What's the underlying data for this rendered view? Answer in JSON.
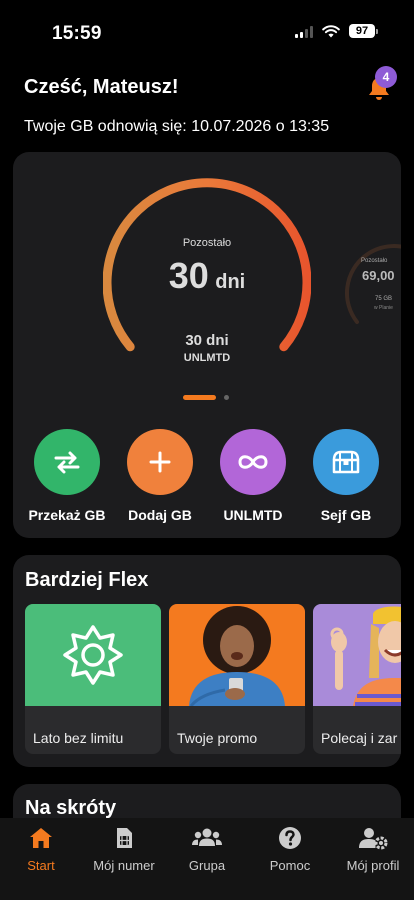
{
  "status_bar": {
    "time": "15:59",
    "battery": "97"
  },
  "header": {
    "greeting": "Cześć, Mateusz!",
    "notification_count": "4",
    "renewal_text": "Twoje GB odnowią się: 10.07.2026 o 13:35"
  },
  "data_card": {
    "gauge_main": {
      "caption": "Pozostało",
      "value": "30",
      "unit": "dni",
      "sub_value": "30 dni",
      "sub_label": "UNLMTD",
      "fill_fraction": 1.0
    },
    "gauge_peek": {
      "caption": "Pozostało",
      "value": "69,00",
      "gb_text": "75 GB",
      "plan_text": "w Planie"
    },
    "pager": {
      "pages": 2,
      "active": 0
    },
    "actions": [
      {
        "label": "Przekaż GB",
        "icon": "transfer-icon",
        "color": "#32b56a"
      },
      {
        "label": "Dodaj GB",
        "icon": "plus-icon",
        "color": "#f0813c"
      },
      {
        "label": "UNLMTD",
        "icon": "infinity-icon",
        "color": "#b266d8"
      },
      {
        "label": "Sejf GB",
        "icon": "treasure-chest-icon",
        "color": "#3a9bdc"
      }
    ]
  },
  "flex": {
    "title": "Bardziej Flex",
    "promos": [
      {
        "caption": "Lato bez limitu",
        "image": "sun-icon"
      },
      {
        "caption": "Twoje promo",
        "image": "woman-with-phone-photo"
      },
      {
        "caption": "Polecaj i zar",
        "image": "smiling-woman-photo"
      }
    ]
  },
  "shortcuts": {
    "title": "Na skróty"
  },
  "tab_bar": [
    {
      "label": "Start",
      "icon": "home-icon",
      "active": true
    },
    {
      "label": "Mój numer",
      "icon": "sim-card-icon",
      "active": false
    },
    {
      "label": "Grupa",
      "icon": "group-icon",
      "active": false
    },
    {
      "label": "Pomoc",
      "icon": "help-icon",
      "active": false
    },
    {
      "label": "Mój profil",
      "icon": "profile-settings-icon",
      "active": false
    }
  ],
  "colors": {
    "accent": "#f47a1f",
    "card": "#1c1c1e",
    "background": "#000000"
  }
}
